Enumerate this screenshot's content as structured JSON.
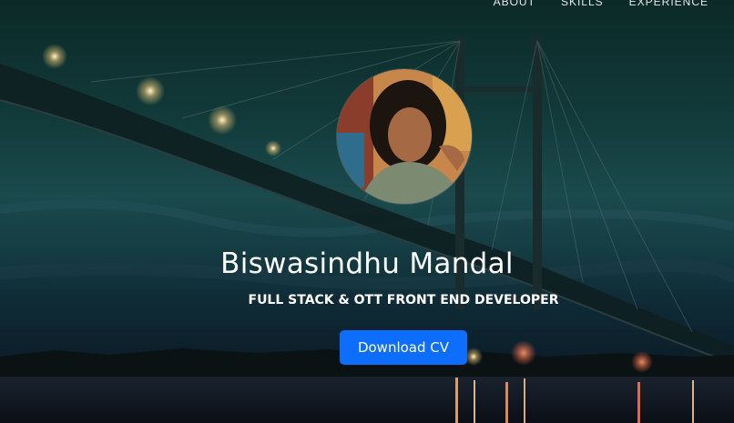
{
  "nav": {
    "items": [
      {
        "label": "ABOUT"
      },
      {
        "label": "SKILLS"
      },
      {
        "label": "EXPERIENCE"
      }
    ]
  },
  "hero": {
    "name": "Biswasindhu Mandal",
    "title": "FULL STACK & OTT FRONT END DEVELOPER",
    "cta_label": "Download CV"
  },
  "colors": {
    "accent": "#0d6efd",
    "text": "#ffffff",
    "background_top": "#0b2a28",
    "background_bottom": "#0a1620"
  }
}
